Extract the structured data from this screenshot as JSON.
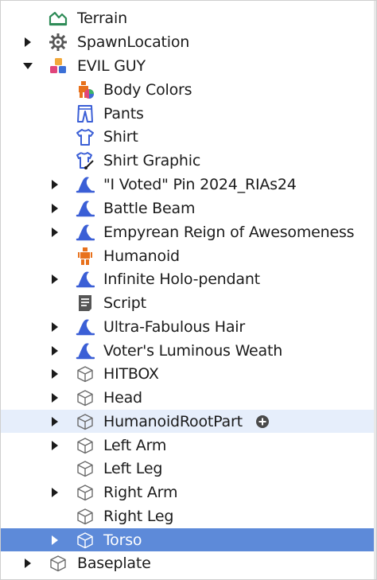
{
  "explorer": {
    "items": [
      {
        "label": "Terrain",
        "icon": "terrain-icon",
        "expander": "none"
      },
      {
        "label": "SpawnLocation",
        "icon": "spawn-location-icon",
        "expander": "collapsed"
      },
      {
        "label": "EVIL GUY",
        "icon": "model-icon",
        "expander": "expanded"
      },
      {
        "label": "Body Colors",
        "icon": "body-colors-icon",
        "expander": "none"
      },
      {
        "label": "Pants",
        "icon": "pants-icon",
        "expander": "none"
      },
      {
        "label": "Shirt",
        "icon": "shirt-icon",
        "expander": "none"
      },
      {
        "label": "Shirt Graphic",
        "icon": "shirt-graphic-icon",
        "expander": "none"
      },
      {
        "label": "\"I Voted\" Pin 2024_RIAs24",
        "icon": "accessory-hat-icon",
        "expander": "collapsed"
      },
      {
        "label": "Battle Beam",
        "icon": "accessory-hat-icon",
        "expander": "collapsed"
      },
      {
        "label": "Empyrean Reign of Awesomeness",
        "icon": "accessory-hat-icon",
        "expander": "collapsed"
      },
      {
        "label": "Humanoid",
        "icon": "humanoid-icon",
        "expander": "none"
      },
      {
        "label": "Infinite Holo-pendant",
        "icon": "accessory-hat-icon",
        "expander": "collapsed"
      },
      {
        "label": "Script",
        "icon": "script-icon",
        "expander": "none"
      },
      {
        "label": "Ultra-Fabulous Hair",
        "icon": "accessory-hat-icon",
        "expander": "collapsed"
      },
      {
        "label": "Voter's Luminous Weath",
        "icon": "accessory-hat-icon",
        "expander": "collapsed"
      },
      {
        "label": "HITBOX",
        "icon": "part-cube-icon",
        "expander": "collapsed"
      },
      {
        "label": "Head",
        "icon": "part-cube-icon",
        "expander": "collapsed"
      },
      {
        "label": "HumanoidRootPart",
        "icon": "part-cube-icon",
        "expander": "collapsed",
        "state": "hover",
        "insert_button": "plus-circle-icon"
      },
      {
        "label": "Left Arm",
        "icon": "part-cube-icon",
        "expander": "collapsed"
      },
      {
        "label": "Left Leg",
        "icon": "part-cube-icon",
        "expander": "none"
      },
      {
        "label": "Right Arm",
        "icon": "part-cube-icon",
        "expander": "collapsed"
      },
      {
        "label": "Right Leg",
        "icon": "part-cube-icon",
        "expander": "none"
      },
      {
        "label": "Torso",
        "icon": "part-cube-icon",
        "expander": "collapsed",
        "state": "selected"
      },
      {
        "label": "Baseplate",
        "icon": "part-cube-icon",
        "expander": "collapsed"
      }
    ]
  },
  "colors": {
    "selected": "#5d8ad9",
    "hover": "#e6eefb",
    "accessory": "#3b5fd6",
    "terrain": "#2e8b57",
    "humanoid": "#e8711c"
  }
}
